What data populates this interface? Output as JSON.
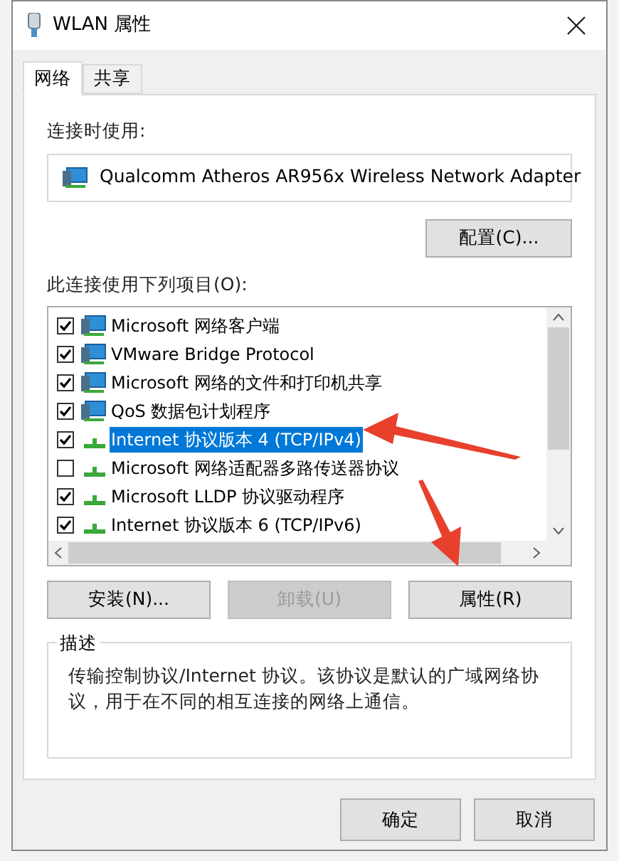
{
  "window": {
    "title": "WLAN 属性"
  },
  "tabs": [
    {
      "label": "网络",
      "selected": true
    },
    {
      "label": "共享",
      "selected": false
    }
  ],
  "connect_using": {
    "label": "连接时使用:",
    "adapter": "Qualcomm Atheros AR956x Wireless Network Adapter",
    "configure_button": "配置(C)..."
  },
  "items_label": "此连接使用下列项目(O):",
  "items": [
    {
      "kind": "service",
      "label": "Microsoft 网络客户端",
      "checked": true,
      "selected": false
    },
    {
      "kind": "service",
      "label": "VMware Bridge Protocol",
      "checked": true,
      "selected": false
    },
    {
      "kind": "service",
      "label": "Microsoft 网络的文件和打印机共享",
      "checked": true,
      "selected": false
    },
    {
      "kind": "service",
      "label": "QoS 数据包计划程序",
      "checked": true,
      "selected": false
    },
    {
      "kind": "protocol",
      "label": "Internet 协议版本 4 (TCP/IPv4)",
      "checked": true,
      "selected": true
    },
    {
      "kind": "protocol",
      "label": "Microsoft 网络适配器多路传送器协议",
      "checked": false,
      "selected": false
    },
    {
      "kind": "protocol",
      "label": "Microsoft LLDP 协议驱动程序",
      "checked": true,
      "selected": false
    },
    {
      "kind": "protocol",
      "label": "Internet 协议版本 6 (TCP/IPv6)",
      "checked": true,
      "selected": false
    }
  ],
  "item_buttons": [
    {
      "label": "安装(N)...",
      "disabled": false
    },
    {
      "label": "卸载(U)",
      "disabled": true
    },
    {
      "label": "属性(R)",
      "disabled": false
    }
  ],
  "description": {
    "title": "描述",
    "text": "传输控制协议/Internet 协议。该协议是默认的广域网络协议，用于在不同的相互连接的网络上通信。"
  },
  "dialog_buttons": [
    "确定",
    "取消"
  ]
}
